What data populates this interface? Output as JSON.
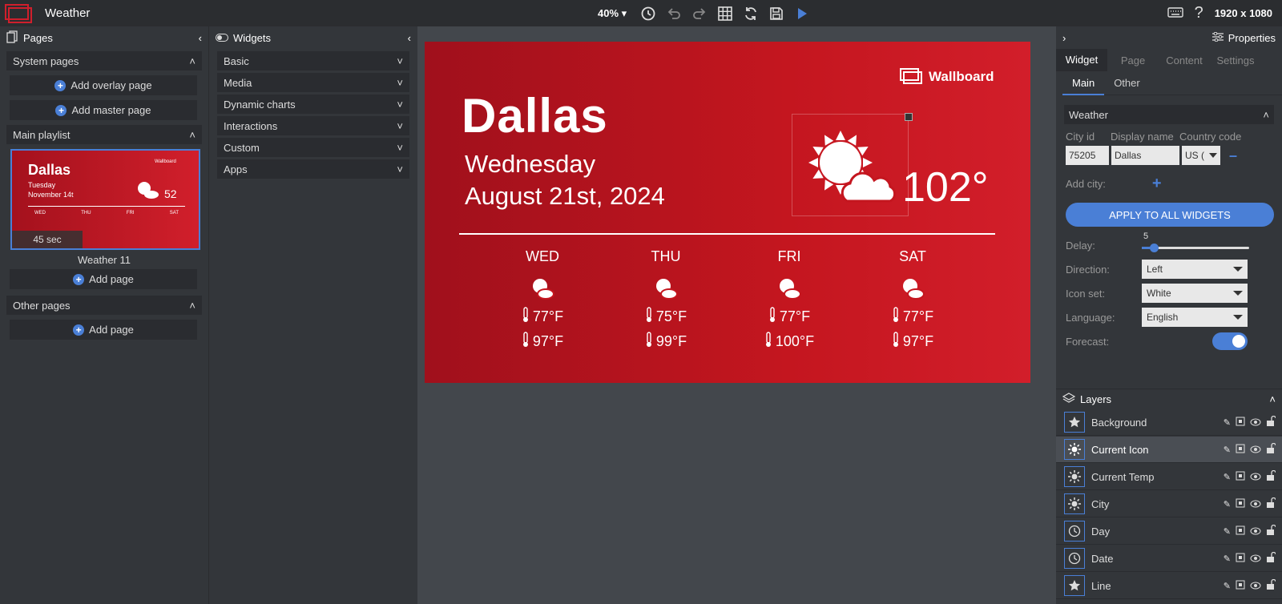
{
  "app": {
    "title": "Weather"
  },
  "toolbar": {
    "zoom": "40%",
    "resolution": "1920 x 1080"
  },
  "pages": {
    "header": "Pages",
    "system_pages": "System pages",
    "add_overlay": "Add overlay page",
    "add_master": "Add master page",
    "main_playlist": "Main playlist",
    "thumb": {
      "city": "Dallas",
      "day": "Tuesday",
      "date": "November 14t",
      "temp": "52",
      "logo": "Wallboard",
      "days": [
        "WED",
        "THU",
        "FRI",
        "SAT"
      ],
      "duration": "45 sec"
    },
    "thumb_label": "Weather 11",
    "add_page": "Add page",
    "other_pages": "Other pages",
    "add_page_other": "Add page"
  },
  "widgets": {
    "header": "Widgets",
    "sections": [
      "Basic",
      "Media",
      "Dynamic charts",
      "Interactions",
      "Custom",
      "Apps"
    ]
  },
  "slide": {
    "city": "Dallas",
    "day": "Wednesday",
    "date": "August 21st, 2024",
    "logo": "Wallboard",
    "temp": "102°",
    "forecast": [
      {
        "day": "WED",
        "low": "77°F",
        "high": "97°F"
      },
      {
        "day": "THU",
        "low": "75°F",
        "high": "99°F"
      },
      {
        "day": "FRI",
        "low": "77°F",
        "high": "100°F"
      },
      {
        "day": "SAT",
        "low": "77°F",
        "high": "97°F"
      }
    ]
  },
  "properties": {
    "header": "Properties",
    "tabs": [
      "Widget",
      "Page",
      "Content",
      "Settings"
    ],
    "subtabs": [
      "Main",
      "Other"
    ],
    "section": "Weather",
    "columns": [
      "City id",
      "Display name",
      "Country code"
    ],
    "city_id": "75205",
    "display_name": "Dallas",
    "country_code": "US (",
    "add_city": "Add city:",
    "apply": "APPLY TO ALL WIDGETS",
    "delay_label": "Delay:",
    "delay_value": "5",
    "direction_label": "Direction:",
    "direction_value": "Left",
    "iconset_label": "Icon set:",
    "iconset_value": "White",
    "language_label": "Language:",
    "language_value": "English",
    "forecast_label": "Forecast:",
    "forecast_on": true
  },
  "layers": {
    "header": "Layers",
    "items": [
      {
        "name": "Background",
        "icon": "star-icon"
      },
      {
        "name": "Current Icon",
        "icon": "sun-icon"
      },
      {
        "name": "Current Temp",
        "icon": "sun-icon"
      },
      {
        "name": "City",
        "icon": "sun-icon"
      },
      {
        "name": "Day",
        "icon": "clock-icon"
      },
      {
        "name": "Date",
        "icon": "clock-icon"
      },
      {
        "name": "Line",
        "icon": "star-icon"
      }
    ]
  },
  "colors": {
    "accent": "#4a7fd6",
    "slide_red": "#c4161f",
    "panel": "#33363a"
  }
}
